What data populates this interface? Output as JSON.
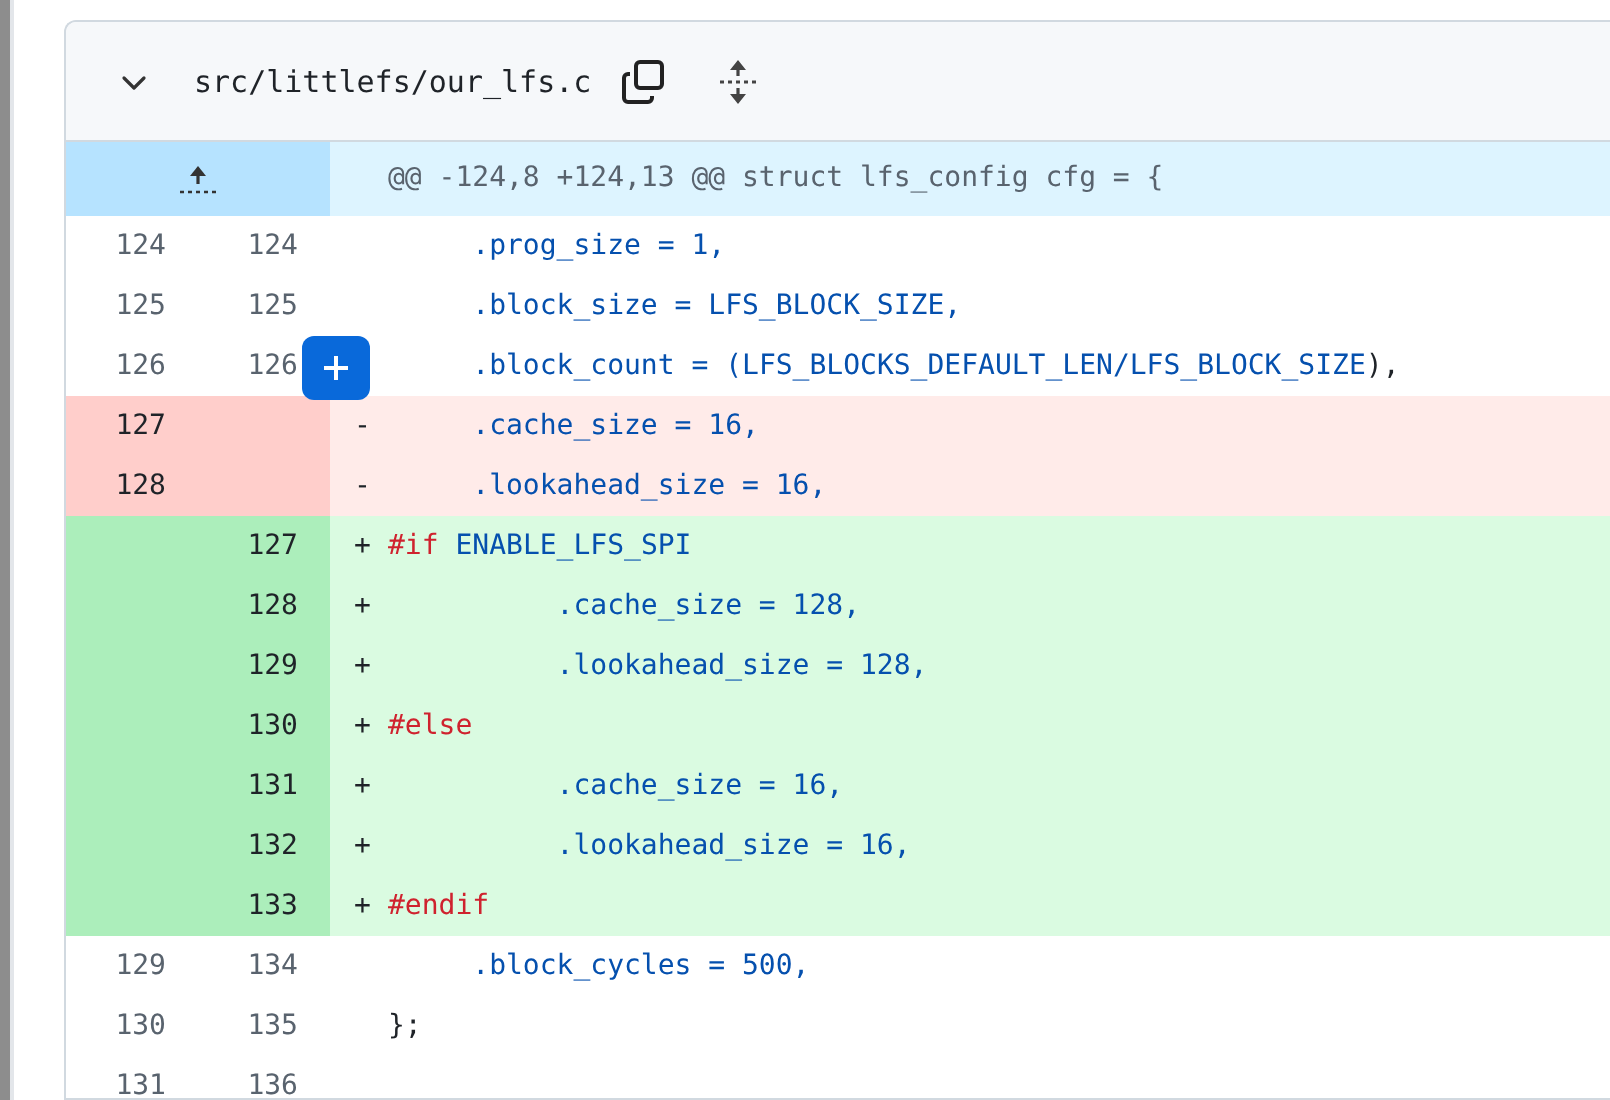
{
  "file": {
    "name": "src/littlefs/our_lfs.c",
    "expanded": true
  },
  "hunk": {
    "header": "@@ -124,8 +124,13 @@ struct lfs_config cfg = {"
  },
  "lines": [
    {
      "kind": "context",
      "old": "124",
      "new": "124",
      "tokens": [
        {
          "text": "     .prog_size = 1,",
          "kind": "constant"
        }
      ]
    },
    {
      "kind": "context",
      "old": "125",
      "new": "125",
      "tokens": [
        {
          "text": "     .block_size = LFS_BLOCK_SIZE,",
          "kind": "constant"
        }
      ]
    },
    {
      "kind": "context",
      "old": "126",
      "new": "126",
      "comment_button": true,
      "tokens": [
        {
          "text": "     .block_count = (",
          "kind": "constant"
        },
        {
          "text": "LFS_BLOCKS_DEFAULT_LEN/LFS_BLOCK_SIZE",
          "kind": "constant"
        },
        {
          "text": "),",
          "kind": "plain"
        }
      ]
    },
    {
      "kind": "deletion",
      "old": "127",
      "marker": "-",
      "tokens": [
        {
          "text": "     .cache_size = 16,",
          "kind": "constant"
        }
      ]
    },
    {
      "kind": "deletion",
      "old": "128",
      "marker": "-",
      "tokens": [
        {
          "text": "     .lookahead_size = 16,",
          "kind": "constant"
        }
      ]
    },
    {
      "kind": "addition",
      "new": "127",
      "marker": "+",
      "tokens": [
        {
          "text": "#if",
          "kind": "keyword"
        },
        {
          "text": " ENABLE_LFS_SPI",
          "kind": "constant"
        }
      ]
    },
    {
      "kind": "addition",
      "new": "128",
      "marker": "+",
      "tokens": [
        {
          "text": "          .cache_size = 128,",
          "kind": "constant"
        }
      ]
    },
    {
      "kind": "addition",
      "new": "129",
      "marker": "+",
      "tokens": [
        {
          "text": "          .lookahead_size = 128,",
          "kind": "constant"
        }
      ]
    },
    {
      "kind": "addition",
      "new": "130",
      "marker": "+",
      "tokens": [
        {
          "text": "#else",
          "kind": "keyword"
        }
      ]
    },
    {
      "kind": "addition",
      "new": "131",
      "marker": "+",
      "tokens": [
        {
          "text": "          .cache_size = 16,",
          "kind": "constant"
        }
      ]
    },
    {
      "kind": "addition",
      "new": "132",
      "marker": "+",
      "tokens": [
        {
          "text": "          .lookahead_size = 16,",
          "kind": "constant"
        }
      ]
    },
    {
      "kind": "addition",
      "new": "133",
      "marker": "+",
      "tokens": [
        {
          "text": "#endif",
          "kind": "keyword"
        }
      ]
    },
    {
      "kind": "context",
      "old": "129",
      "new": "134",
      "tokens": [
        {
          "text": "     .block_cycles = 500,",
          "kind": "constant"
        }
      ]
    },
    {
      "kind": "context",
      "old": "130",
      "new": "135",
      "tokens": [
        {
          "text": "};",
          "kind": "plain"
        }
      ]
    },
    {
      "kind": "context",
      "old": "131",
      "new": "136"
    }
  ]
}
